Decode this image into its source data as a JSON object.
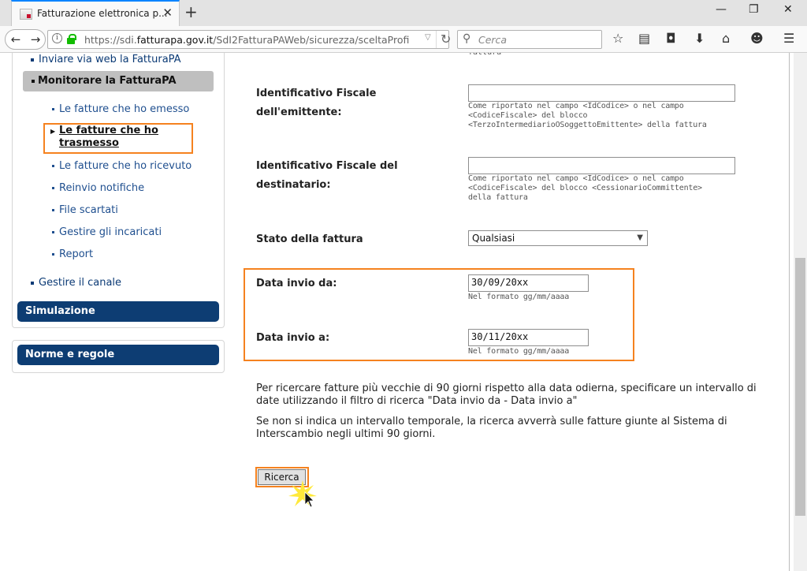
{
  "browser": {
    "tab_title": "Fatturazione elettronica p...",
    "tab_close": "✕",
    "new_tab": "+",
    "url_prefix": "https://sdi.",
    "url_domain": "fatturapa.gov.it",
    "url_path": "/SdI2FatturaPAWeb/sicurezza/sceltaProfi",
    "search_placeholder": "Cerca",
    "window_controls": {
      "minimize": "—",
      "restore": "❐",
      "close": "✕"
    }
  },
  "sidebar": {
    "top_link": "Inviare via web la FatturaPA",
    "section": "Monitorare la FatturaPA",
    "items": [
      "Le fatture che ho emesso",
      "Le fatture che ho trasmesso",
      "Le fatture che ho ricevuto",
      "Reinvio notifiche",
      "File scartati",
      "Gestire gli incaricati",
      "Report"
    ],
    "bottom_link": "Gestire il canale",
    "simulazione": "Simulazione",
    "norme": "Norme e regole"
  },
  "form": {
    "cut_text": "fattura",
    "emittente_label_1": "Identificativo Fiscale",
    "emittente_label_2": "dell'emittente:",
    "emittente_value": "",
    "emittente_hint": "Come riportato nel campo <IdCodice> o nel campo <CodiceFiscale> del blocco <TerzoIntermediarioOSoggettoEmittente> della fattura",
    "destinatario_label_1": "Identificativo Fiscale del",
    "destinatario_label_2": "destinatario:",
    "destinatario_value": "",
    "destinatario_hint": "Come riportato nel campo <IdCodice> o nel campo <CodiceFiscale> del blocco <CessionarioCommittente> della fattura",
    "stato_label": "Stato della fattura",
    "stato_value": "Qualsiasi",
    "data_da_label": "Data invio da:",
    "data_da_value": "30/09/20xx",
    "data_da_hint": "Nel formato gg/mm/aaaa",
    "data_a_label": "Data invio a:",
    "data_a_value": "30/11/20xx",
    "data_a_hint": "Nel formato gg/mm/aaaa",
    "info_1": "Per ricercare fatture più vecchie di 90 giorni rispetto alla data odierna, specificare un intervallo di date utilizzando il filtro di ricerca \"Data invio da - Data invio a\"",
    "info_2": "Se non si indica un intervallo temporale, la ricerca avverrà sulle fatture giunte al Sistema di Interscambio negli ultimi 90 giorni.",
    "search_button": "Ricerca"
  },
  "accent_colors": {
    "highlight": "#f5821f",
    "nav_blue": "#0d3d73",
    "link": "#0b3a75"
  }
}
